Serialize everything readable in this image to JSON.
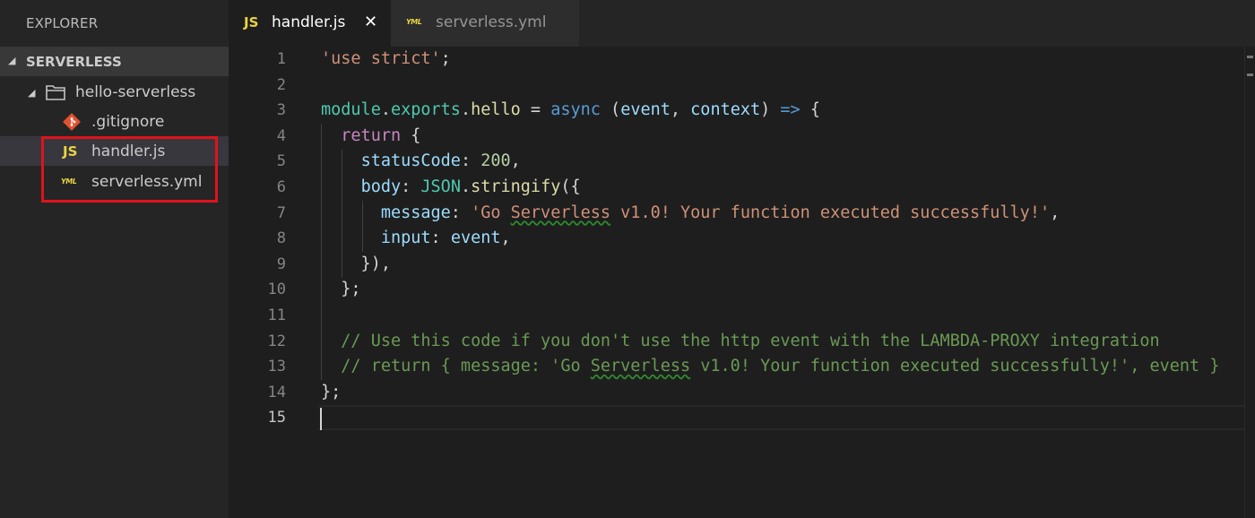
{
  "sidebar": {
    "title": "EXPLORER",
    "section": "SERVERLESS",
    "folder": "hello-serverless",
    "files": [
      {
        "name": ".gitignore",
        "icon": "git-icon"
      },
      {
        "name": "handler.js",
        "icon": "js-icon",
        "icon_text": "JS"
      },
      {
        "name": "serverless.yml",
        "icon": "yml-icon",
        "icon_text": "YML"
      }
    ]
  },
  "tabs": [
    {
      "label": "handler.js",
      "icon_text": "JS",
      "active": true,
      "close": "✕"
    },
    {
      "label": "serverless.yml",
      "icon_text": "YML",
      "active": false
    }
  ],
  "editor": {
    "line_numbers": [
      "1",
      "2",
      "3",
      "4",
      "5",
      "6",
      "7",
      "8",
      "9",
      "10",
      "11",
      "12",
      "13",
      "14",
      "15"
    ],
    "tokens": {
      "use_strict": "'use strict'",
      "module": "module",
      "exports": "exports",
      "hello": "hello",
      "async": "async",
      "event": "event",
      "context": "context",
      "arrow": "=>",
      "return": "return",
      "statusCode": "statusCode",
      "status_value": "200",
      "body": "body",
      "json": "JSON",
      "stringify": "stringify",
      "message": "message",
      "message_str_a": "'Go ",
      "message_str_b": "Serverless",
      "message_str_c": " v1.0! Your function executed successfully!'",
      "input": "input",
      "comment12": "// Use this code if you don't use the http event with the LAMBDA-PROXY integration",
      "comment13_a": "// return { message: 'Go ",
      "comment13_b": "Serverless",
      "comment13_c": " v1.0! Your function executed successfully!', event }"
    }
  },
  "colors": {
    "keyword": "#569cd6",
    "string": "#ce9178",
    "comment": "#6a9955",
    "number": "#b5cea8",
    "variable": "#9cdcfe",
    "function": "#dcdcaa",
    "class": "#4ec9b0",
    "highlight_box": "#e0131b"
  }
}
